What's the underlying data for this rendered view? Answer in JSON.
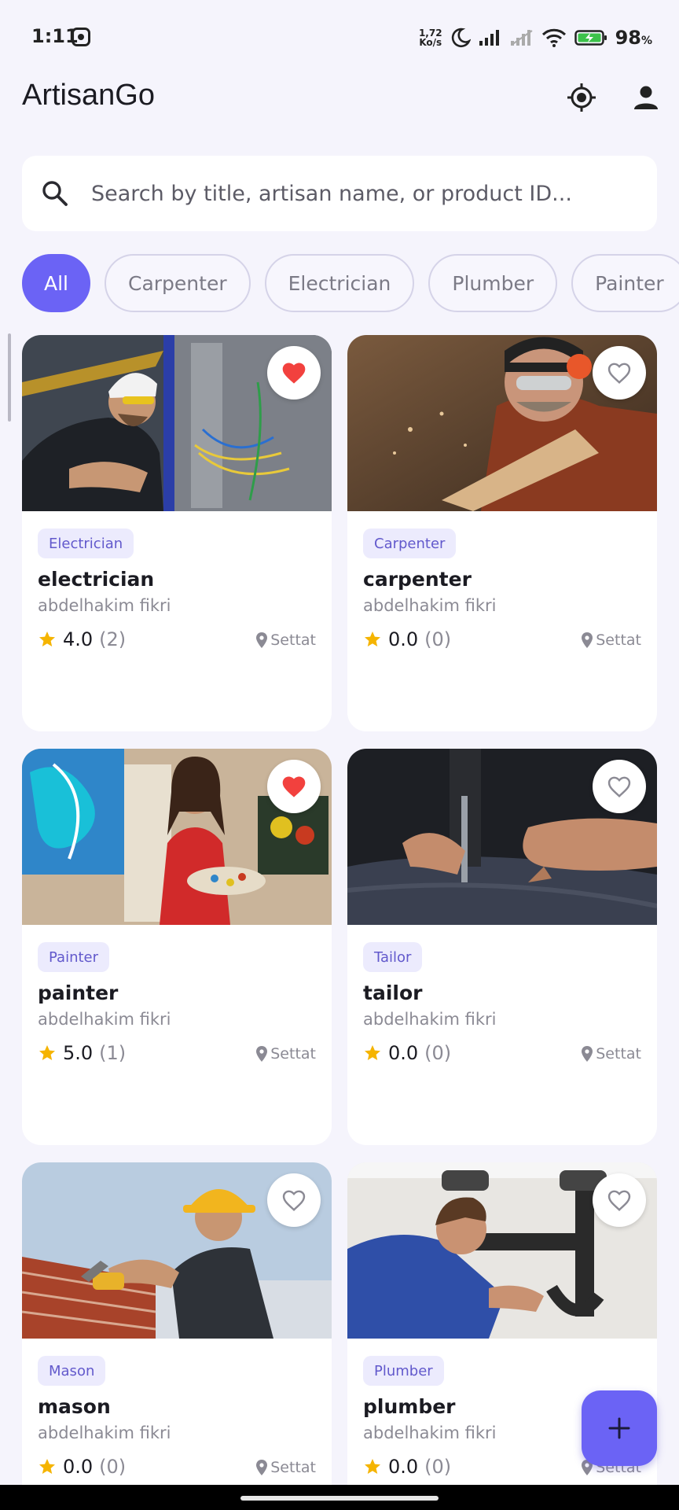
{
  "status_bar": {
    "time": "1:11",
    "net_speed_top": "1,72",
    "net_speed_bottom": "Ko/s",
    "battery_percent": "98",
    "battery_unit": "%"
  },
  "header": {
    "title": "ArtisanGo",
    "location_icon": "my-location-icon",
    "profile_icon": "person-icon"
  },
  "search": {
    "placeholder": "Search by title, artisan name, or product ID..."
  },
  "filters": {
    "selected": "All",
    "chips": [
      "All",
      "Carpenter",
      "Electrician",
      "Plumber",
      "Painter"
    ]
  },
  "cards": [
    {
      "category": "Electrician",
      "title": "electrician",
      "artisan": "abdelhakim fikri",
      "rating": "4.0",
      "reviews": "(2)",
      "location": "Settat",
      "favorite": true,
      "image": "electrician-photo"
    },
    {
      "category": "Carpenter",
      "title": "carpenter",
      "artisan": "abdelhakim fikri",
      "rating": "0.0",
      "reviews": "(0)",
      "location": "Settat",
      "favorite": false,
      "image": "carpenter-photo"
    },
    {
      "category": "Painter",
      "title": "painter",
      "artisan": "abdelhakim fikri",
      "rating": "5.0",
      "reviews": "(1)",
      "location": "Settat",
      "favorite": true,
      "image": "painter-photo"
    },
    {
      "category": "Tailor",
      "title": "tailor",
      "artisan": "abdelhakim fikri",
      "rating": "0.0",
      "reviews": "(0)",
      "location": "Settat",
      "favorite": false,
      "image": "tailor-photo"
    },
    {
      "category": "Mason",
      "title": "mason",
      "artisan": "abdelhakim fikri",
      "rating": "0.0",
      "reviews": "(0)",
      "location": "Settat",
      "favorite": false,
      "image": "mason-photo"
    },
    {
      "category": "Plumber",
      "title": "plumber",
      "artisan": "abdelhakim fikri",
      "rating": "0.0",
      "reviews": "(0)",
      "location": "Settat",
      "favorite": false,
      "image": "plumber-photo"
    }
  ],
  "fab": {
    "icon": "plus-icon"
  },
  "colors": {
    "accent": "#6b63f5",
    "favorite": "#f2413e",
    "star": "#f5b400",
    "background": "#f5f4fc"
  }
}
